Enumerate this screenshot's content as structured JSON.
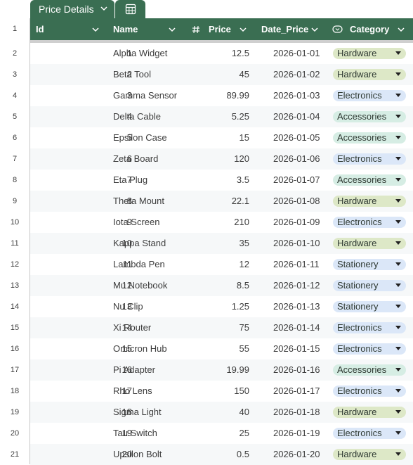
{
  "tab": {
    "label": "Price Details",
    "icon": "calculator-icon"
  },
  "columns": [
    {
      "label": "Id",
      "icon": ""
    },
    {
      "label": "Name",
      "icon": ""
    },
    {
      "label": "Price",
      "icon": "hash-icon"
    },
    {
      "label": "Date_Price",
      "icon": ""
    },
    {
      "label": "Category",
      "icon": "dropdown-chip-icon"
    }
  ],
  "header_row_number": "1",
  "category_colors": {
    "Hardware": "#dde8c7",
    "Electronics": "#dbe7f8",
    "Accessories": "#d6ede4",
    "Stationery": "#dbe7f8"
  },
  "rows": [
    {
      "rownum": "2",
      "id": "1",
      "name": "Alpha Widget",
      "price": "12.5",
      "date": "2026-01-01",
      "category": "Hardware"
    },
    {
      "rownum": "3",
      "id": "2",
      "name": "Beta Tool",
      "price": "45",
      "date": "2026-01-02",
      "category": "Hardware"
    },
    {
      "rownum": "4",
      "id": "3",
      "name": "Gamma Sensor",
      "price": "89.99",
      "date": "2026-01-03",
      "category": "Electronics"
    },
    {
      "rownum": "5",
      "id": "4",
      "name": "Delta Cable",
      "price": "5.25",
      "date": "2026-01-04",
      "category": "Accessories"
    },
    {
      "rownum": "6",
      "id": "5",
      "name": "Epsilon Case",
      "price": "15",
      "date": "2026-01-05",
      "category": "Accessories"
    },
    {
      "rownum": "7",
      "id": "6",
      "name": "Zeta Board",
      "price": "120",
      "date": "2026-01-06",
      "category": "Electronics"
    },
    {
      "rownum": "8",
      "id": "7",
      "name": "Eta Plug",
      "price": "3.5",
      "date": "2026-01-07",
      "category": "Accessories"
    },
    {
      "rownum": "9",
      "id": "8",
      "name": "Theta Mount",
      "price": "22.1",
      "date": "2026-01-08",
      "category": "Hardware"
    },
    {
      "rownum": "10",
      "id": "9",
      "name": "Iota Screen",
      "price": "210",
      "date": "2026-01-09",
      "category": "Electronics"
    },
    {
      "rownum": "11",
      "id": "10",
      "name": "Kappa Stand",
      "price": "35",
      "date": "2026-01-10",
      "category": "Hardware"
    },
    {
      "rownum": "12",
      "id": "11",
      "name": "Lambda Pen",
      "price": "12",
      "date": "2026-01-11",
      "category": "Stationery"
    },
    {
      "rownum": "13",
      "id": "12",
      "name": "Mu Notebook",
      "price": "8.5",
      "date": "2026-01-12",
      "category": "Stationery"
    },
    {
      "rownum": "14",
      "id": "13",
      "name": "Nu Clip",
      "price": "1.25",
      "date": "2026-01-13",
      "category": "Stationery"
    },
    {
      "rownum": "15",
      "id": "14",
      "name": "Xi Router",
      "price": "75",
      "date": "2026-01-14",
      "category": "Electronics"
    },
    {
      "rownum": "16",
      "id": "15",
      "name": "Omicron Hub",
      "price": "55",
      "date": "2026-01-15",
      "category": "Electronics"
    },
    {
      "rownum": "17",
      "id": "16",
      "name": "Pi Adapter",
      "price": "19.99",
      "date": "2026-01-16",
      "category": "Accessories"
    },
    {
      "rownum": "18",
      "id": "17",
      "name": "Rho Lens",
      "price": "150",
      "date": "2026-01-17",
      "category": "Electronics"
    },
    {
      "rownum": "19",
      "id": "18",
      "name": "Sigma Light",
      "price": "40",
      "date": "2026-01-18",
      "category": "Hardware"
    },
    {
      "rownum": "20",
      "id": "19",
      "name": "Tau Switch",
      "price": "25",
      "date": "2026-01-19",
      "category": "Electronics"
    },
    {
      "rownum": "21",
      "id": "20",
      "name": "Upsilon Bolt",
      "price": "0.5",
      "date": "2026-01-20",
      "category": "Hardware"
    }
  ]
}
